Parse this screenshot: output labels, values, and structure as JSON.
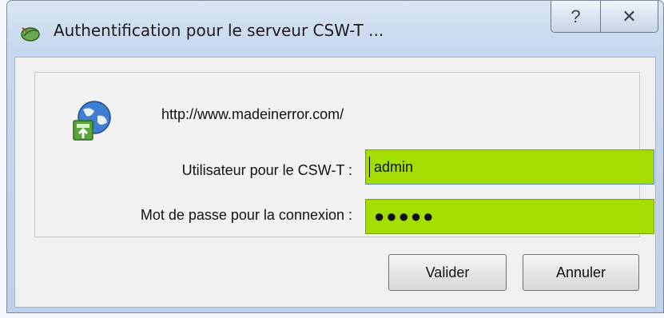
{
  "window": {
    "title": "Authentification pour le serveur CSW-T ...",
    "help_icon": "?",
    "close_icon": "✕"
  },
  "dialog": {
    "url": "http://www.madeinerror.com/",
    "user_label": "Utilisateur pour le CSW-T :",
    "user_value": "admin",
    "password_label": "Mot de passe pour la connexion :",
    "password_mask": "●●●●●",
    "field_color": "#a3de00"
  },
  "buttons": {
    "ok_label": "Valider",
    "cancel_label": "Annuler"
  },
  "icons": {
    "app": "leaf-app-icon",
    "server": "globe-server-icon"
  }
}
